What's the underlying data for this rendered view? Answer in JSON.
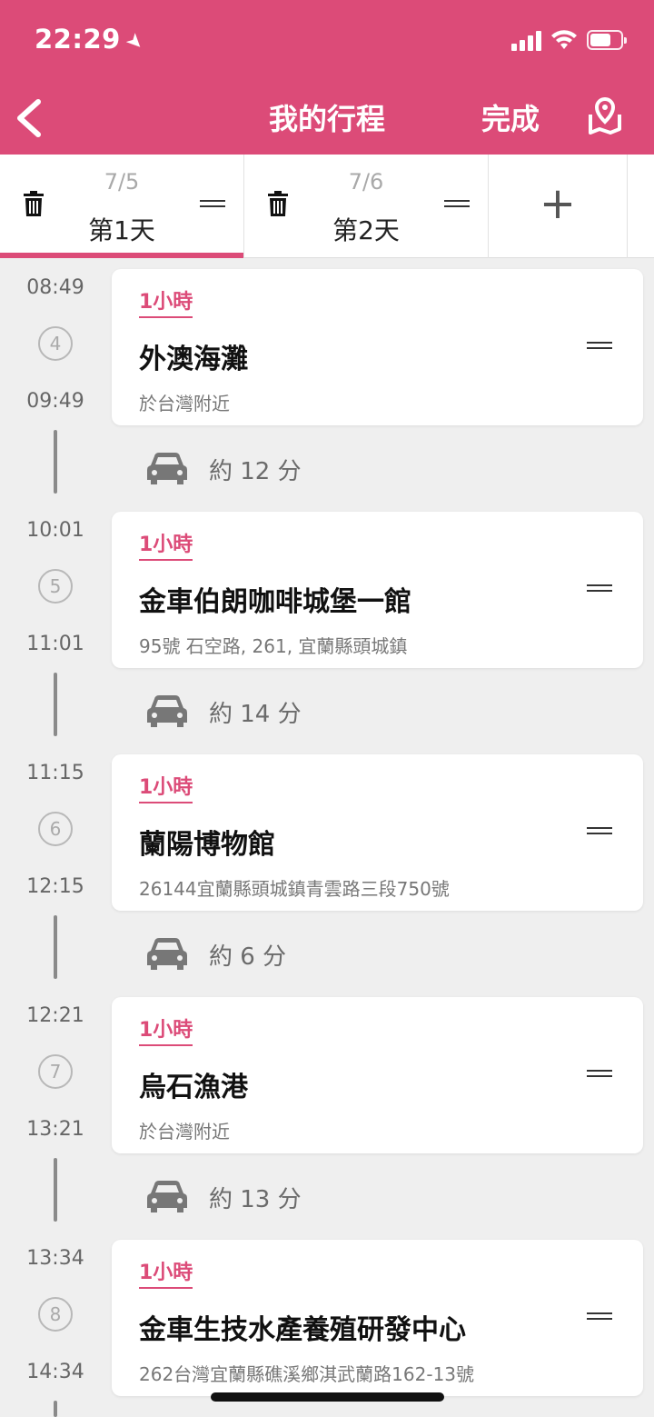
{
  "status": {
    "time": "22:29",
    "location_arrow": "➤"
  },
  "nav": {
    "title": "我的行程",
    "done_label": "完成",
    "back_icon": "chevron-left-icon",
    "map_icon": "map-icon"
  },
  "tabs": [
    {
      "date": "7/5",
      "label": "第1天",
      "selected": true
    },
    {
      "date": "7/6",
      "label": "第2天",
      "selected": false
    }
  ],
  "add_tab_label": "+",
  "accent_color": "#dc4b78",
  "stops": [
    {
      "number": "4",
      "start": "08:49",
      "end": "09:49",
      "duration": "1小時",
      "name": "外澳海灘",
      "address": "於台灣附近",
      "transit": "約 12 分"
    },
    {
      "number": "5",
      "start": "10:01",
      "end": "11:01",
      "duration": "1小時",
      "name": "金車伯朗咖啡城堡一館",
      "address": "95號 石空路, 261, 宜蘭縣頭城鎮",
      "transit": "約 14 分"
    },
    {
      "number": "6",
      "start": "11:15",
      "end": "12:15",
      "duration": "1小時",
      "name": "蘭陽博物館",
      "address": "26144宜蘭縣頭城鎮青雲路三段750號",
      "transit": "約 6 分"
    },
    {
      "number": "7",
      "start": "12:21",
      "end": "13:21",
      "duration": "1小時",
      "name": "烏石漁港",
      "address": "於台灣附近",
      "transit": "約 13 分"
    },
    {
      "number": "8",
      "start": "13:34",
      "end": "14:34",
      "duration": "1小時",
      "name": "金車生技水產養殖研發中心",
      "address": "262台灣宜蘭縣礁溪鄉淇武蘭路162-13號"
    }
  ]
}
